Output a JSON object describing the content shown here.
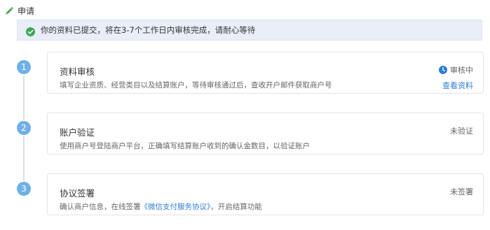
{
  "header": {
    "title": "申请",
    "icon": "pencil-icon"
  },
  "notice": {
    "icon": "check-circle-icon",
    "text": "你的资料已提交，将在3-7个工作日内审核完成，请耐心等待"
  },
  "steps": [
    {
      "number": "1",
      "title": "资料审核",
      "description": "填写企业资质、经营类目以及结算账户，等待审核通过后，查收开户邮件获取商户号",
      "status": "审核中",
      "status_icon": "clock-icon",
      "link": "查看资料"
    },
    {
      "number": "2",
      "title": "账户验证",
      "description": "使用商户号登陆商户平台，正确填写结算账户收到的确认金数目，以验证账户",
      "status": "未验证"
    },
    {
      "number": "3",
      "title": "协议签署",
      "description_prefix": "确认商户信息，在线签署",
      "description_link": "《微信支付服务协议》",
      "description_suffix": "，开启结算功能",
      "status": "未签署"
    }
  ],
  "colors": {
    "accent": "#2f7cd3",
    "step_circle": "#6fb0e6",
    "success": "#3aa853",
    "notice_bg": "#e9eef8"
  }
}
